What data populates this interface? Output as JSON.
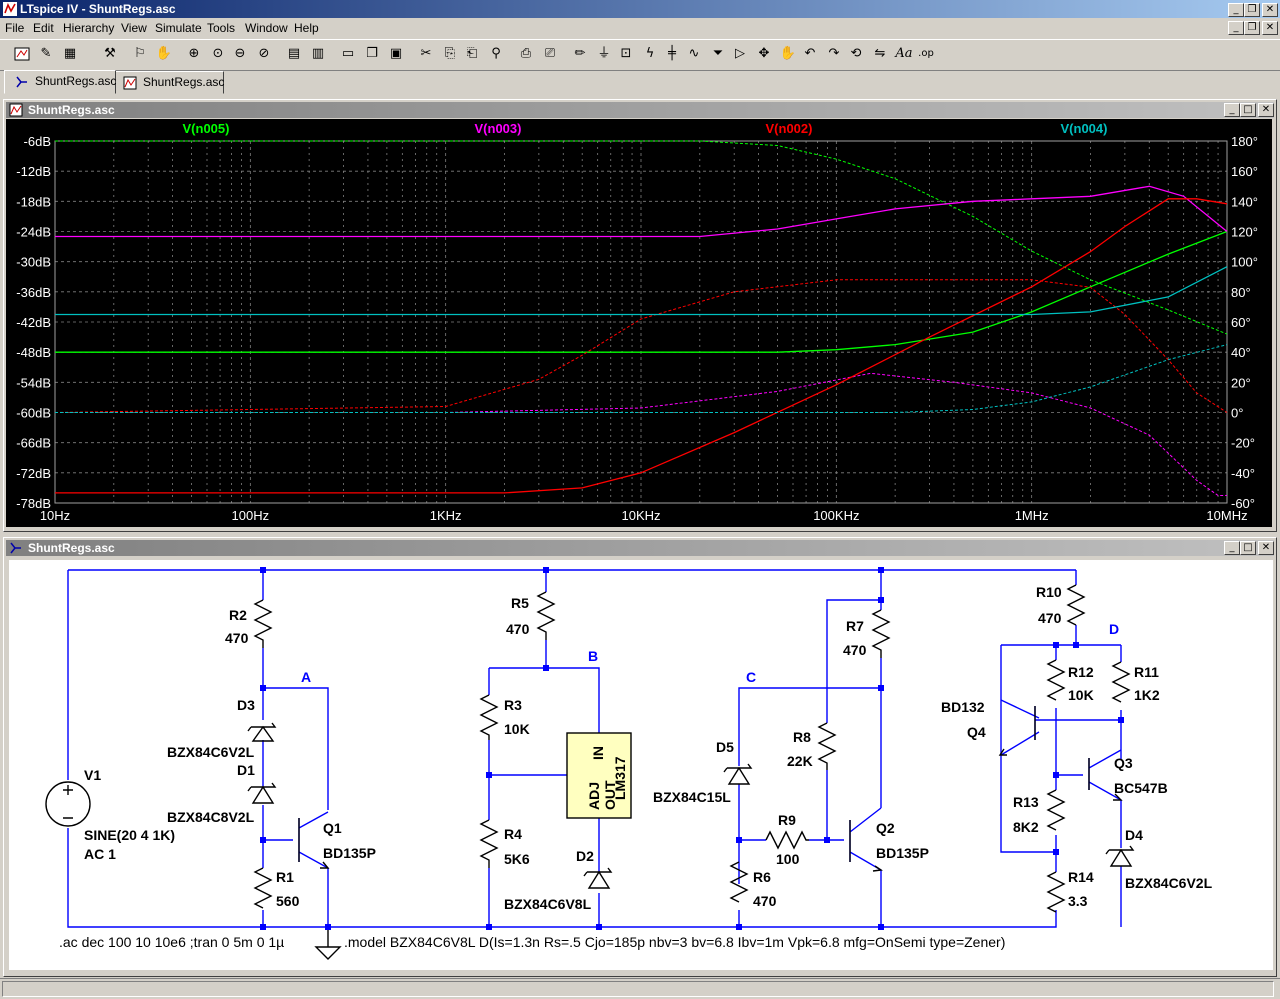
{
  "app": {
    "title": "LTspice IV - ShuntRegs.asc"
  },
  "menu": [
    "File",
    "Edit",
    "Hierarchy",
    "View",
    "Simulate",
    "Tools",
    "Window",
    "Help"
  ],
  "toolbar": {
    "icons": [
      "open-icon",
      "save-icon",
      "run-icon",
      "halt-icon",
      "zoom-in-icon",
      "zoom-out-icon",
      "cut-icon",
      "copy-icon",
      "paste-icon",
      "find-icon",
      "print-icon",
      "wire-icon",
      "ground-icon",
      "label-icon",
      "resistor-icon",
      "capacitor-icon",
      "inductor-icon",
      "diode-icon",
      "component-icon",
      "move-icon",
      "drag-icon",
      "undo-icon",
      "redo-icon",
      "rotate-icon",
      "mirror-icon",
      "text-icon",
      "spice-directive-icon"
    ]
  },
  "tabs": [
    {
      "label": "ShuntRegs.asc",
      "icon": "schematic-icon"
    },
    {
      "label": "ShuntRegs.asc",
      "icon": "waveform-icon"
    }
  ],
  "plot_window": {
    "title": "ShuntRegs.asc"
  },
  "schematic_window": {
    "title": "ShuntRegs.asc"
  },
  "colors": {
    "green": "#00ff00",
    "magenta": "#ff00ff",
    "red": "#ff0000",
    "cyan": "#00c0c0",
    "plot_bg": "#000000",
    "wire": "#0000ff",
    "grid": "#808080"
  },
  "chart_data": {
    "type": "line",
    "x_scale": "log",
    "xlim": [
      10,
      10000000
    ],
    "ylim": [
      -78,
      -6
    ],
    "y2lim": [
      -60,
      180
    ],
    "x_ticks": [
      "10Hz",
      "100Hz",
      "1KHz",
      "10KHz",
      "100KHz",
      "1MHz",
      "10MHz"
    ],
    "y_ticks": [
      "-6dB",
      "-12dB",
      "-18dB",
      "-24dB",
      "-30dB",
      "-36dB",
      "-42dB",
      "-48dB",
      "-54dB",
      "-60dB",
      "-66dB",
      "-72dB",
      "-78dB"
    ],
    "y2_ticks": [
      "180°",
      "160°",
      "140°",
      "120°",
      "100°",
      "80°",
      "60°",
      "40°",
      "20°",
      "0°",
      "-20°",
      "-40°",
      "-60°"
    ],
    "grid": true,
    "series": [
      {
        "name": "V(n005)",
        "color": "#00ff00",
        "magnitude": [
          [
            10,
            -48
          ],
          [
            20000,
            -48
          ],
          [
            50000,
            -48
          ],
          [
            100000,
            -47.5
          ],
          [
            200000,
            -46.5
          ],
          [
            500000,
            -44
          ],
          [
            1000000,
            -40
          ],
          [
            2000000,
            -35
          ],
          [
            5000000,
            -28.5
          ],
          [
            10000000,
            -24
          ]
        ],
        "phase": [
          [
            10,
            180
          ],
          [
            20000,
            180
          ],
          [
            50000,
            177
          ],
          [
            100000,
            168
          ],
          [
            200000,
            155
          ],
          [
            500000,
            130
          ],
          [
            1000000,
            107
          ],
          [
            2000000,
            88
          ],
          [
            5000000,
            68
          ],
          [
            10000000,
            52
          ]
        ]
      },
      {
        "name": "V(n003)",
        "color": "#ff00ff",
        "magnitude": [
          [
            10,
            -25
          ],
          [
            20000,
            -25
          ],
          [
            50000,
            -23.5
          ],
          [
            100000,
            -21.5
          ],
          [
            200000,
            -19.5
          ],
          [
            500000,
            -18
          ],
          [
            1000000,
            -17.5
          ],
          [
            2000000,
            -17
          ],
          [
            4000000,
            -15
          ],
          [
            6000000,
            -17
          ],
          [
            10000000,
            -24
          ]
        ],
        "phase": [
          [
            10,
            0
          ],
          [
            1000,
            0
          ],
          [
            10000,
            3
          ],
          [
            50000,
            14
          ],
          [
            150000,
            26
          ],
          [
            400000,
            20
          ],
          [
            1000000,
            13
          ],
          [
            2000000,
            3
          ],
          [
            4000000,
            -15
          ],
          [
            7000000,
            -45
          ],
          [
            9000000,
            -55
          ],
          [
            10000000,
            -55
          ]
        ]
      },
      {
        "name": "V(n002)",
        "color": "#ff0000",
        "magnitude": [
          [
            10,
            -76
          ],
          [
            2000,
            -76
          ],
          [
            5000,
            -75
          ],
          [
            10000,
            -72
          ],
          [
            30000,
            -64
          ],
          [
            100000,
            -54.5
          ],
          [
            300000,
            -45
          ],
          [
            1000000,
            -35
          ],
          [
            2000000,
            -28
          ],
          [
            3000000,
            -23
          ],
          [
            5000000,
            -17.5
          ],
          [
            7000000,
            -17.5
          ],
          [
            10000000,
            -18.5
          ]
        ],
        "phase": [
          [
            10,
            0
          ],
          [
            1000,
            4
          ],
          [
            3000,
            22
          ],
          [
            5000,
            38
          ],
          [
            10000,
            62
          ],
          [
            30000,
            80
          ],
          [
            100000,
            88
          ],
          [
            300000,
            88
          ],
          [
            1000000,
            88
          ],
          [
            2000000,
            83
          ],
          [
            3000000,
            65
          ],
          [
            5000000,
            35
          ],
          [
            7000000,
            13
          ],
          [
            10000000,
            0
          ]
        ]
      },
      {
        "name": "V(n004)",
        "color": "#00c0c0",
        "magnitude": [
          [
            10,
            -40.5
          ],
          [
            1000000,
            -40.5
          ],
          [
            2000000,
            -40
          ],
          [
            5000000,
            -37
          ],
          [
            10000000,
            -31
          ]
        ],
        "phase": [
          [
            10,
            0
          ],
          [
            200000,
            0
          ],
          [
            500000,
            2
          ],
          [
            1000000,
            7
          ],
          [
            2000000,
            17
          ],
          [
            5000000,
            35
          ],
          [
            10000000,
            45
          ]
        ]
      }
    ]
  },
  "schematic": {
    "labels": {
      "R2": "R2",
      "R2v": "470",
      "D3": "D3",
      "D3v": "BZX84C6V2L",
      "D1": "D1",
      "D1v": "BZX84C8V2L",
      "Q1": "Q1",
      "Q1v": "BD135P",
      "R1": "R1",
      "R1v": "560",
      "A": "A",
      "V1": "V1",
      "V1v": "SINE(20 4 1K)",
      "V1ac": "AC 1",
      "R5": "R5",
      "R5v": "470",
      "B": "B",
      "R3": "R3",
      "R3v": "10K",
      "R4": "R4",
      "R4v": "5K6",
      "U1a": "ADJ",
      "U1b": "OUT",
      "U1c": "IN",
      "U1d": "LM317",
      "D2": "D2",
      "D2v": "BZX84C6V8L",
      "C": "C",
      "R7": "R7",
      "R7v": "470",
      "R8": "R8",
      "R8v": "22K",
      "D5": "D5",
      "D5v": "BZX84C15L",
      "R9": "R9",
      "R9v": "100",
      "Q2": "Q2",
      "Q2v": "BD135P",
      "R6": "R6",
      "R6v": "470",
      "R10": "R10",
      "R10v": "470",
      "D": "D",
      "R12": "R12",
      "R12v": "10K",
      "R11": "R11",
      "R11v": "1K2",
      "Q4a": "BD132",
      "Q4": "Q4",
      "Q3": "Q3",
      "Q3v": "BC547B",
      "R13": "R13",
      "R13v": "8K2",
      "D4": "D4",
      "D4v": "BZX84C6V2L",
      "R14": "R14",
      "R14v": "3.3"
    },
    "directive1": ".ac dec 100 10 10e6  ;tran 0 5m 0 1µ",
    "directive2": ".model BZX84C6V8L D(Is=1.3n Rs=.5 Cjo=185p nbv=3 bv=6.8 Ibv=1m Vpk=6.8 mfg=OnSemi type=Zener)"
  }
}
